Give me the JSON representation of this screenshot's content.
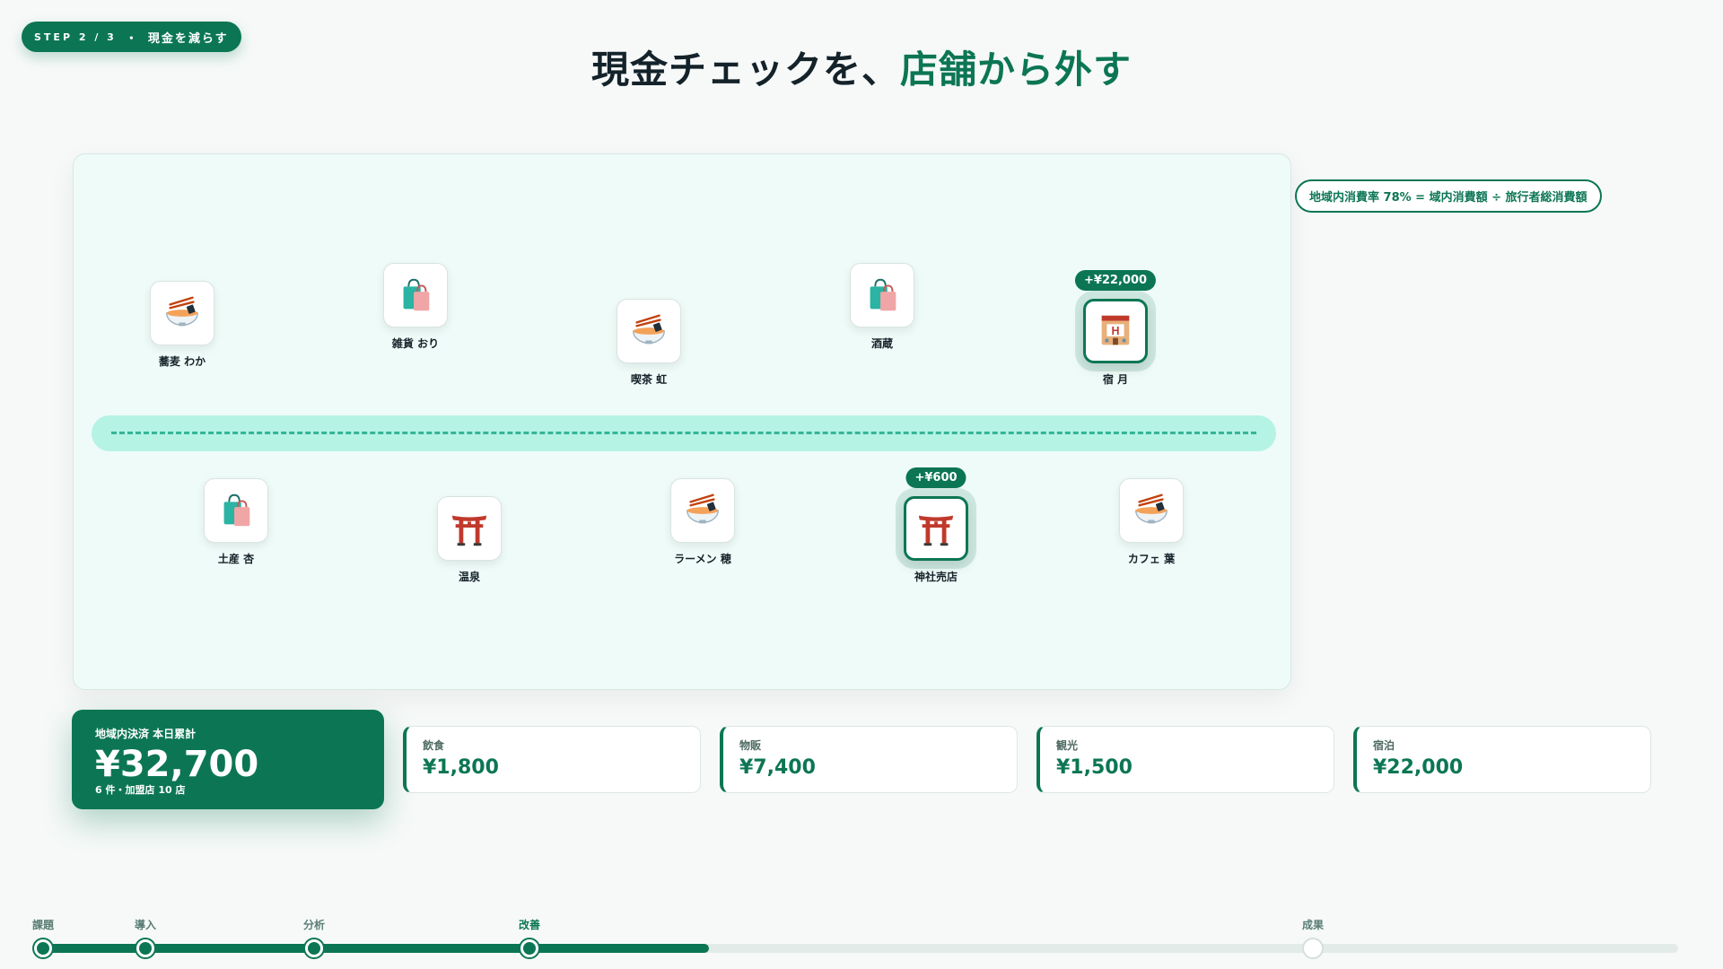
{
  "step": {
    "label": "STEP 2 / 3",
    "separator": "・",
    "name": "現金を減らす"
  },
  "title": {
    "main": "現金チェックを、",
    "accent": "店舗から外す"
  },
  "formula": "地域内消費率 78% = 域内消費額 ÷ 旅行者総消費額",
  "shops_top": [
    {
      "name": "蕎麦 わか",
      "icon": "ramen-bowl-icon",
      "highlight": false,
      "amount": ""
    },
    {
      "name": "雑貨 おり",
      "icon": "shopping-bags-icon",
      "highlight": false,
      "amount": ""
    },
    {
      "name": "喫茶 虹",
      "icon": "ramen-bowl-icon",
      "highlight": false,
      "amount": ""
    },
    {
      "name": "酒蔵",
      "icon": "shopping-bags-icon",
      "highlight": false,
      "amount": ""
    },
    {
      "name": "宿 月",
      "icon": "hotel-icon",
      "highlight": true,
      "amount": "+¥22,000"
    }
  ],
  "shops_bottom": [
    {
      "name": "土産 杏",
      "icon": "shopping-bags-icon",
      "highlight": false,
      "amount": ""
    },
    {
      "name": "温泉",
      "icon": "torii-gate-icon",
      "highlight": false,
      "amount": ""
    },
    {
      "name": "ラーメン 穂",
      "icon": "ramen-bowl-icon",
      "highlight": false,
      "amount": ""
    },
    {
      "name": "神社売店",
      "icon": "torii-gate-icon",
      "highlight": true,
      "amount": "+¥600"
    },
    {
      "name": "カフェ 葉",
      "icon": "ramen-bowl-icon",
      "highlight": false,
      "amount": ""
    }
  ],
  "total": {
    "label": "地域内決済 本日累計",
    "amount": "¥32,700",
    "sub": "6 件・加盟店 10 店"
  },
  "categories": [
    {
      "label": "飲食",
      "value": "¥1,800"
    },
    {
      "label": "物販",
      "value": "¥7,400"
    },
    {
      "label": "観光",
      "value": "¥1,500"
    },
    {
      "label": "宿泊",
      "value": "¥22,000"
    }
  ],
  "timeline": {
    "progress": 0.41,
    "milestones": [
      {
        "label": "課題",
        "state": "done"
      },
      {
        "label": "導入",
        "state": "done"
      },
      {
        "label": "分析",
        "state": "done"
      },
      {
        "label": "改善",
        "state": "current"
      },
      {
        "label": "成果",
        "state": "future"
      }
    ]
  },
  "colors": {
    "accent": "#0c7654",
    "road": "#b5f3e5",
    "map_bg": "#effbf8"
  }
}
